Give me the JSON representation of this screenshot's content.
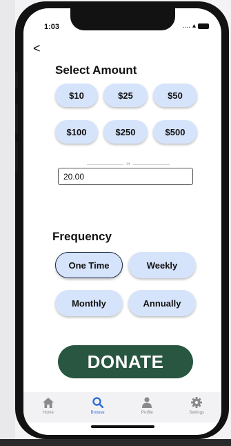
{
  "status_bar": {
    "time": "1:03",
    "signal": "....",
    "wifi": "▴"
  },
  "back": {
    "glyph": "<"
  },
  "amount": {
    "title": "Select Amount",
    "options": [
      "$10",
      "$25",
      "$50",
      "$100",
      "$250",
      "$500"
    ],
    "divider_text": "or",
    "input_value": "20.00"
  },
  "frequency": {
    "title": "Frequency",
    "options": [
      "One Time",
      "Weekly",
      "Monthly",
      "Annually"
    ],
    "selected": "One Time"
  },
  "donate_label": "DONATE",
  "tabs": [
    {
      "label": "Home",
      "icon": "home-icon",
      "active": false
    },
    {
      "label": "Browse",
      "icon": "search-icon",
      "active": true
    },
    {
      "label": "Profile",
      "icon": "user-icon",
      "active": false
    },
    {
      "label": "Settings",
      "icon": "gear-icon",
      "active": false
    }
  ],
  "colors": {
    "pill_bg": "#d6e4fb",
    "donate_bg": "#285640",
    "active_tab": "#2f6fd6",
    "inactive_tab": "#8a8a8a"
  }
}
